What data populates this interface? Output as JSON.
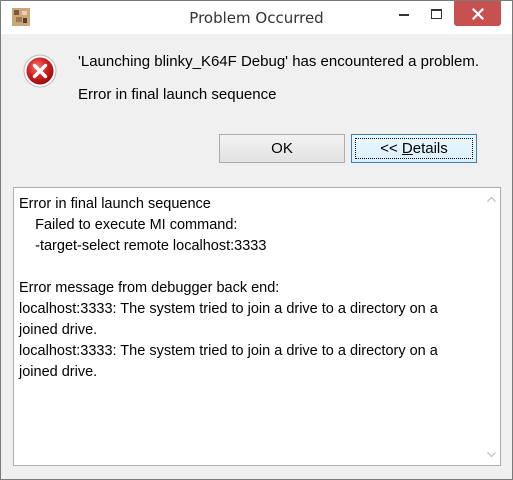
{
  "window": {
    "title": "Problem Occurred",
    "close_color": "#c75050"
  },
  "message": {
    "line1": "'Launching blinky_K64F Debug' has encountered a problem.",
    "line2": "Error in final launch sequence",
    "icon": "error-icon"
  },
  "buttons": {
    "ok_label": "OK",
    "details_prefix": "<< ",
    "details_mnemonic": "D",
    "details_rest": "etails"
  },
  "details": {
    "lines": [
      "Error in final launch sequence",
      "    Failed to execute MI command:",
      "    -target-select remote localhost:3333",
      "",
      "Error message from debugger back end:",
      "localhost:3333: The system tried to join a drive to a directory on a joined drive.",
      "localhost:3333: The system tried to join a drive to a directory on a joined drive."
    ]
  }
}
